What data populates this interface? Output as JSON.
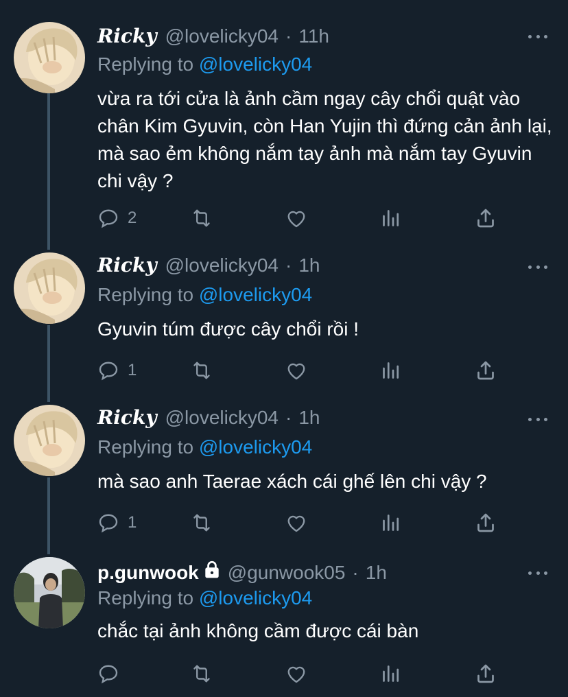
{
  "tweets": [
    {
      "name": "Ricky",
      "handle": "@lovelicky04",
      "time": "11h",
      "replying_prefix": "Replying to",
      "replying_to": "@lovelicky04",
      "text": "vừa ra tới cửa là ảnh cầm ngay cây chổi quật vào chân Kim Gyuvin, còn Han Yujin thì đứng cản ảnh lại, mà sao ẻm không nắm tay ảnh mà nắm tay Gyuvin chi vậy ?",
      "reply_count": "2",
      "avatar": "avatar-blond",
      "locked": false
    },
    {
      "name": "Ricky",
      "handle": "@lovelicky04",
      "time": "1h",
      "replying_prefix": "Replying to",
      "replying_to": "@lovelicky04",
      "text": "Gyuvin túm được cây chổi rồi !",
      "reply_count": "1",
      "avatar": "avatar-blond",
      "locked": false
    },
    {
      "name": "Ricky",
      "handle": "@lovelicky04",
      "time": "1h",
      "replying_prefix": "Replying to",
      "replying_to": "@lovelicky04",
      "text": "mà sao anh Taerae xách cái ghế lên chi vậy ?",
      "reply_count": "1",
      "avatar": "avatar-blond",
      "locked": false
    },
    {
      "name": "p.gunwook",
      "handle": "@gunwook05",
      "time": "1h",
      "replying_prefix": "Replying to",
      "replying_to": "@lovelicky04",
      "text": "chắc tại ảnh không cầm được cái bàn",
      "reply_count": "",
      "avatar": "avatar-outdoor",
      "locked": true
    }
  ],
  "separator": "·",
  "icons": {
    "reply": "reply-icon",
    "retweet": "retweet-icon",
    "like": "heart-icon",
    "analytics": "analytics-icon",
    "share": "share-icon",
    "more": "more-icon",
    "lock": "lock-icon"
  },
  "colors": {
    "background": "#15202b",
    "text": "#ffffff",
    "muted": "#8b98a5",
    "link": "#1d9bf0",
    "thread_line": "#3d5466"
  }
}
